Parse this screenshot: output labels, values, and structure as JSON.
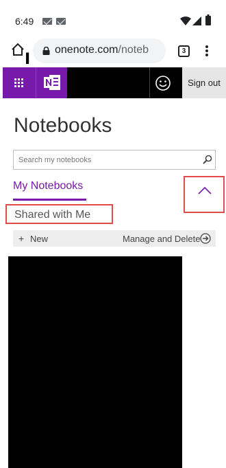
{
  "status_bar": {
    "time": "6:49",
    "icons": [
      "mail-icon",
      "mail-icon",
      "wifi-icon",
      "signal-icon",
      "battery-icon"
    ]
  },
  "browser": {
    "url_main": "onenote.com",
    "url_rest": "/noteb",
    "tab_count": "3",
    "icons": [
      "home-icon",
      "lock-icon",
      "kebab-menu-icon"
    ]
  },
  "app_header": {
    "brand_color": "#7719aa",
    "icons": [
      "waffle-icon",
      "onenote-logo-icon",
      "smiley-icon"
    ],
    "sign_out_label": "Sign out"
  },
  "main": {
    "title": "Notebooks",
    "search": {
      "placeholder": "Search my notebooks",
      "value": ""
    },
    "tabs": [
      {
        "label": "My Notebooks",
        "active": true
      },
      {
        "label": "Shared with Me",
        "active": false
      }
    ],
    "toolbar": {
      "new_icon": "+",
      "new_label": "New",
      "manage_label": "Manage and Delete"
    },
    "highlight_color": "#e34b4b"
  }
}
